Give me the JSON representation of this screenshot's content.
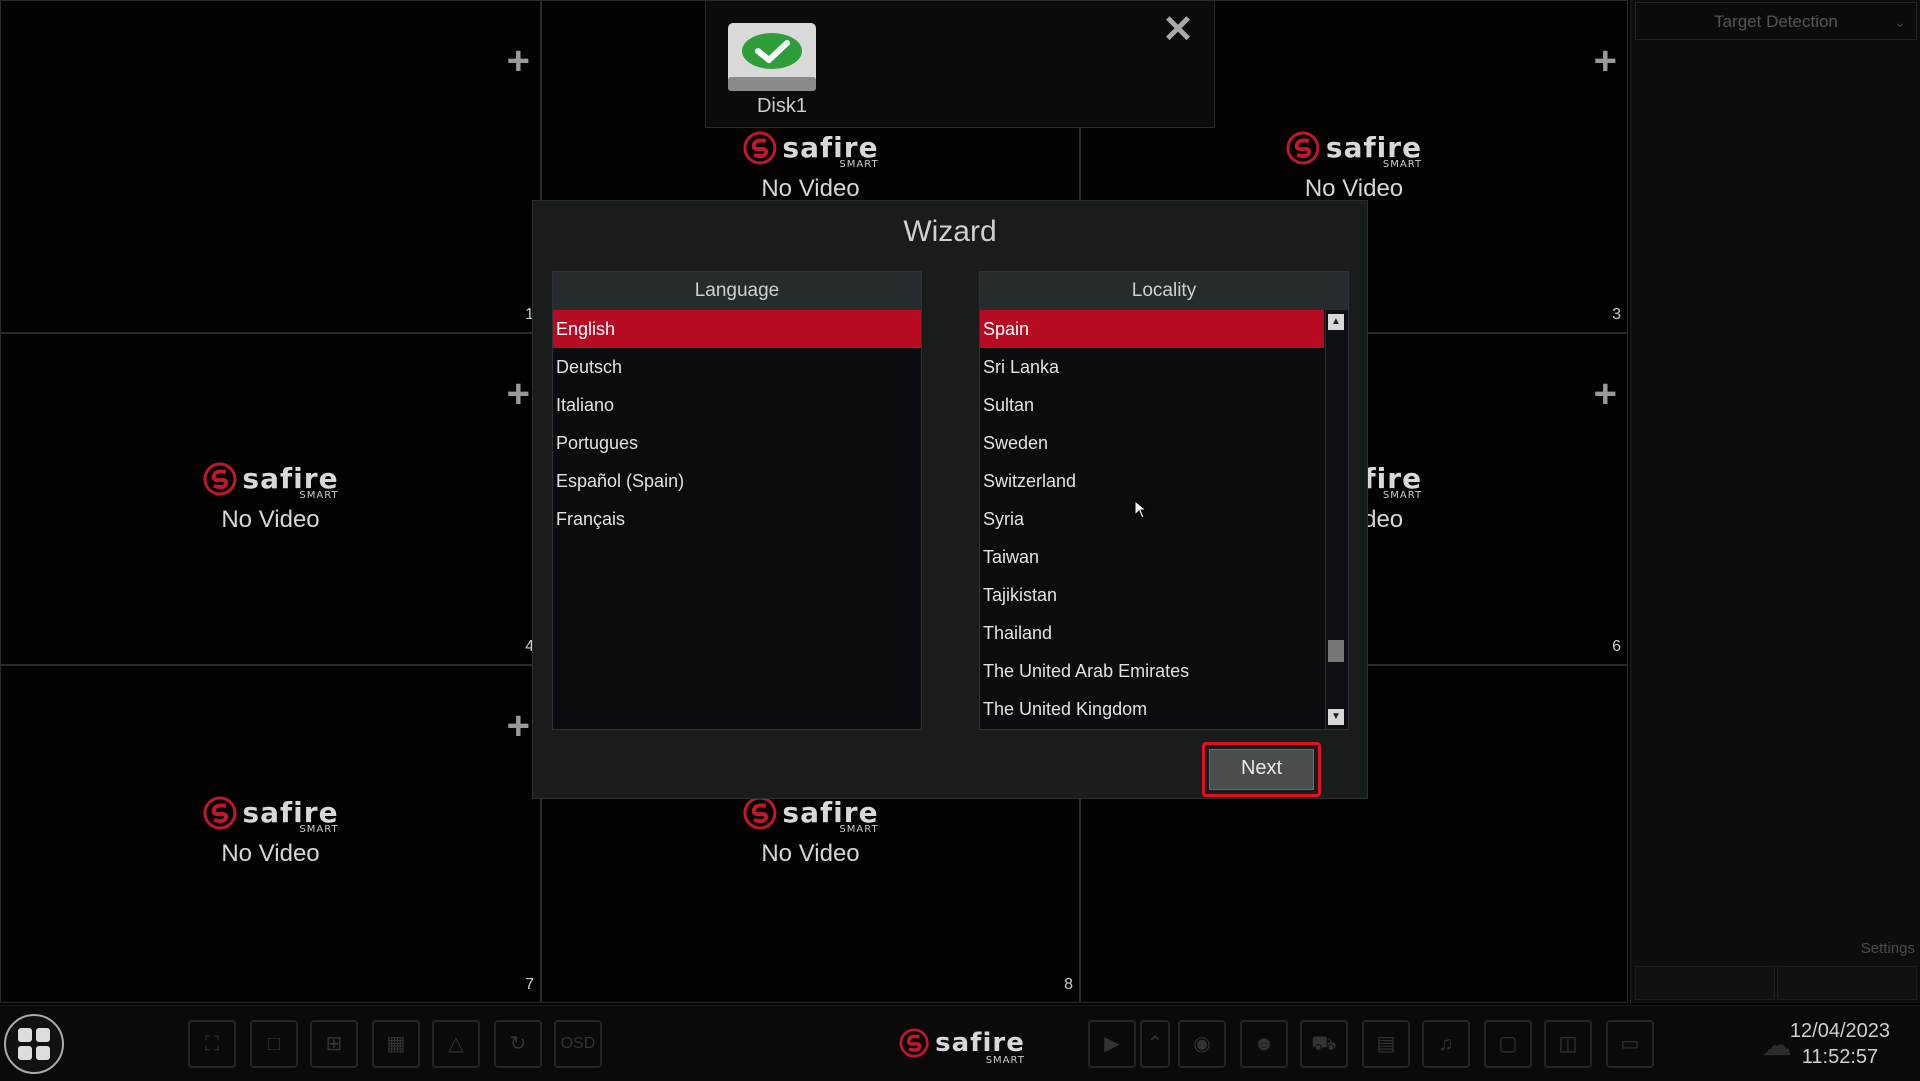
{
  "channels": [
    {
      "number": "1",
      "status": ""
    },
    {
      "number": "",
      "status": "No Video"
    },
    {
      "number": "3",
      "status": "No Video"
    },
    {
      "number": "4",
      "status": "No Video"
    },
    {
      "number": "",
      "status": ""
    },
    {
      "number": "6",
      "status": "No Video"
    },
    {
      "number": "7",
      "status": "No Video"
    },
    {
      "number": "8",
      "status": "No Video"
    },
    {
      "number": "",
      "status": ""
    }
  ],
  "brand": {
    "name": "safire",
    "sub": "SMART"
  },
  "disk_popup": {
    "label": "Disk1",
    "icon": "check-disk-icon"
  },
  "wizard": {
    "title": "Wizard",
    "language": {
      "header": "Language",
      "items": [
        "English",
        "Deutsch",
        "Italiano",
        "Portugues",
        "Español (Spain)",
        "Français"
      ],
      "selected": "English"
    },
    "locality": {
      "header": "Locality",
      "items": [
        "Spain",
        "Sri Lanka",
        "Sultan",
        "Sweden",
        "Switzerland",
        "Syria",
        "Taiwan",
        "Tajikistan",
        "Thailand",
        "The United Arab Emirates",
        "The United Kingdom"
      ],
      "selected": "Spain"
    },
    "next_label": "Next"
  },
  "side_panel": {
    "dropdown": "Target Detection",
    "settings": "Settings"
  },
  "taskbar": {
    "date": "12/04/2023",
    "time": "11:52:57",
    "osd_label": "OSD"
  },
  "colors": {
    "accent": "#b70b24",
    "highlight_border": "#e0121b",
    "logo_red": "#c0182a"
  }
}
